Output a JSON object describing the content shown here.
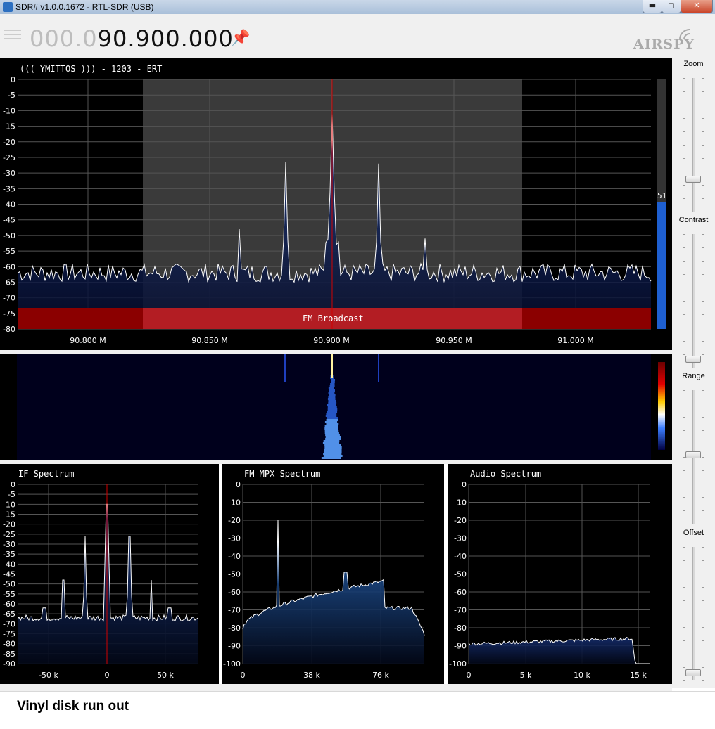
{
  "window": {
    "title": "SDR# v1.0.0.1672 - RTL-SDR (USB)",
    "minimize": "▬",
    "maximize": "◻",
    "close": "✕"
  },
  "toolbar": {
    "freq_dim": "000.0",
    "freq_main": "90.900.000",
    "pin_icon": "pin-icon",
    "logo": "AIRSPY"
  },
  "spectrum": {
    "station_text": "((( YMITTOS  ))) - 1203 - ERT",
    "band_label": "FM Broadcast",
    "snr_value": "51",
    "y_ticks": [
      "0",
      "-5",
      "-10",
      "-15",
      "-20",
      "-25",
      "-30",
      "-35",
      "-40",
      "-45",
      "-50",
      "-55",
      "-60",
      "-65",
      "-70",
      "-75",
      "-80"
    ],
    "x_ticks": [
      "90.800 M",
      "90.850 M",
      "90.900 M",
      "90.950 M",
      "91.000 M"
    ]
  },
  "if_spectrum": {
    "title": "IF Spectrum",
    "y_ticks": [
      "0",
      "-5",
      "-10",
      "-15",
      "-20",
      "-25",
      "-30",
      "-35",
      "-40",
      "-45",
      "-50",
      "-55",
      "-60",
      "-65",
      "-70",
      "-75",
      "-80",
      "-85",
      "-90"
    ],
    "x_ticks": [
      "-50 k",
      "0",
      "50 k"
    ]
  },
  "mpx_spectrum": {
    "title": "FM MPX Spectrum",
    "y_ticks": [
      "0",
      "-10",
      "-20",
      "-30",
      "-40",
      "-50",
      "-60",
      "-70",
      "-80",
      "-90",
      "-100"
    ],
    "x_ticks": [
      "0",
      "38 k",
      "76 k"
    ]
  },
  "audio_spectrum": {
    "title": "Audio Spectrum",
    "y_ticks": [
      "0",
      "-10",
      "-20",
      "-30",
      "-40",
      "-50",
      "-60",
      "-70",
      "-80",
      "-90",
      "-100"
    ],
    "x_ticks": [
      "0",
      "5 k",
      "10 k",
      "15 k"
    ]
  },
  "side_controls": {
    "zoom": "Zoom",
    "contrast": "Contrast",
    "range": "Range",
    "offset": "Offset"
  },
  "caption": "Vinyl disk run out",
  "colors": {
    "accent_blue": "#1e5fd0",
    "band_red": "#8b0000",
    "center_line": "#d00000",
    "trace": "#ffffff"
  }
}
